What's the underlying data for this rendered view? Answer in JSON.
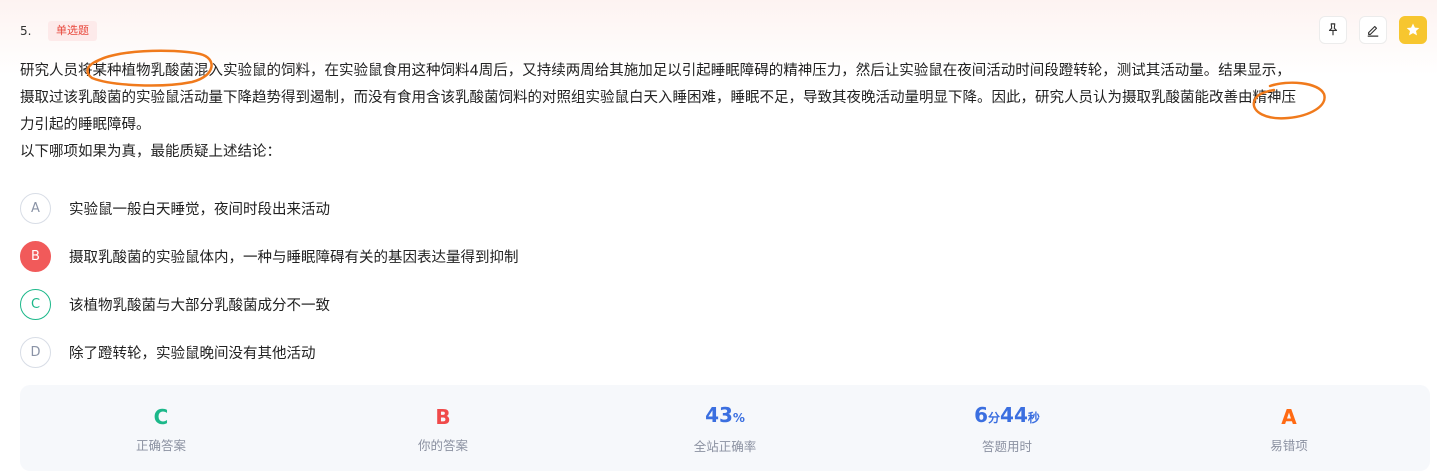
{
  "question": {
    "number": "5.",
    "type_badge": "单选题",
    "stem_line1": "研究人员将某种植物乳酸菌混入实验鼠的饲料，在实验鼠食用这种饲料4周后，又持续两周给其施加足以引起睡眠障碍的精神压力，然后让实验鼠在夜间活动时间段蹬转轮，测试其活动量。结果显示，",
    "stem_line2": "摄取过该乳酸菌的实验鼠活动量下降趋势得到遏制，而没有食用含该乳酸菌饲料的对照组实验鼠白天入睡困难，睡眠不足，导致其夜晚活动量明显下降。因此，研究人员认为摄取乳酸菌能改善由精神压",
    "stem_line3": "力引起的睡眠障碍。",
    "prompt": "以下哪项如果为真，最能质疑上述结论："
  },
  "options": [
    {
      "letter": "A",
      "text": "实验鼠一般白天睡觉，夜间时段出来活动",
      "state": "normal"
    },
    {
      "letter": "B",
      "text": "摄取乳酸菌的实验鼠体内，一种与睡眠障碍有关的基因表达量得到抑制",
      "state": "wrong"
    },
    {
      "letter": "C",
      "text": "该植物乳酸菌与大部分乳酸菌成分不一致",
      "state": "correct"
    },
    {
      "letter": "D",
      "text": "除了蹬转轮，实验鼠晚间没有其他活动",
      "state": "normal"
    }
  ],
  "stats": {
    "correct_answer": {
      "value": "C",
      "label": "正确答案",
      "color": "#1cb88a"
    },
    "your_answer": {
      "value": "B",
      "label": "你的答案",
      "color": "#f04a4a"
    },
    "accuracy": {
      "value": "43",
      "unit": "%",
      "label": "全站正确率",
      "color": "#3b6fe0"
    },
    "time_used": {
      "min": "6",
      "min_unit": "分",
      "sec": "44",
      "sec_unit": "秒",
      "label": "答题用时",
      "color": "#3b6fe0"
    },
    "common_wrong": {
      "value": "A",
      "label": "易错项",
      "color": "#ff6a13"
    }
  },
  "tools": {
    "pin_icon": "pin-icon",
    "edit_icon": "edit-icon",
    "star_icon": "star-icon"
  },
  "annotation_color": "#f07a1c"
}
